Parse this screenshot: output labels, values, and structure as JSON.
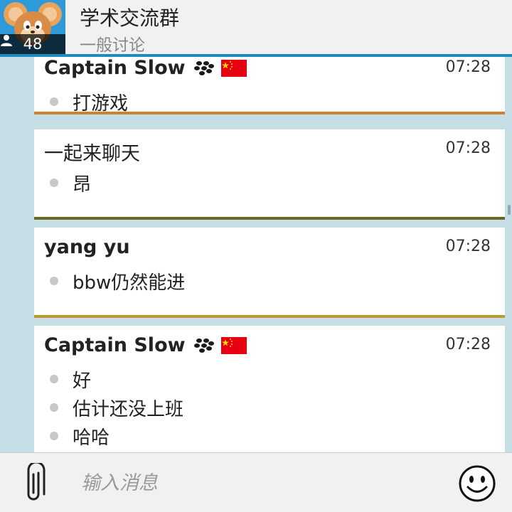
{
  "header": {
    "group_name": "学术交流群",
    "group_topic": "一般讨论",
    "member_count": "48"
  },
  "messages": [
    {
      "sender": "Captain Slow",
      "time": "07:28",
      "texts": [
        "打游戏"
      ],
      "bbm_badge": true,
      "flag": "china-flag-icon",
      "accent": "#c8842f"
    },
    {
      "sender": "一起来聊天",
      "time": "07:28",
      "texts": [
        "昂"
      ],
      "accent": "#6b6a1c"
    },
    {
      "sender": "yang yu",
      "time": "07:28",
      "texts": [
        "bbw仍然能进"
      ],
      "accent": "#b99a2e"
    },
    {
      "sender": "Captain Slow",
      "time": "07:28",
      "texts": [
        "好",
        "估计还没上班",
        "哈哈"
      ],
      "bbm_badge": true,
      "flag": "china-flag-icon"
    }
  ],
  "compose": {
    "placeholder": "输入消息"
  },
  "colors": {
    "header_accent": "#1d8bbd",
    "background": "#c6dfe7"
  }
}
